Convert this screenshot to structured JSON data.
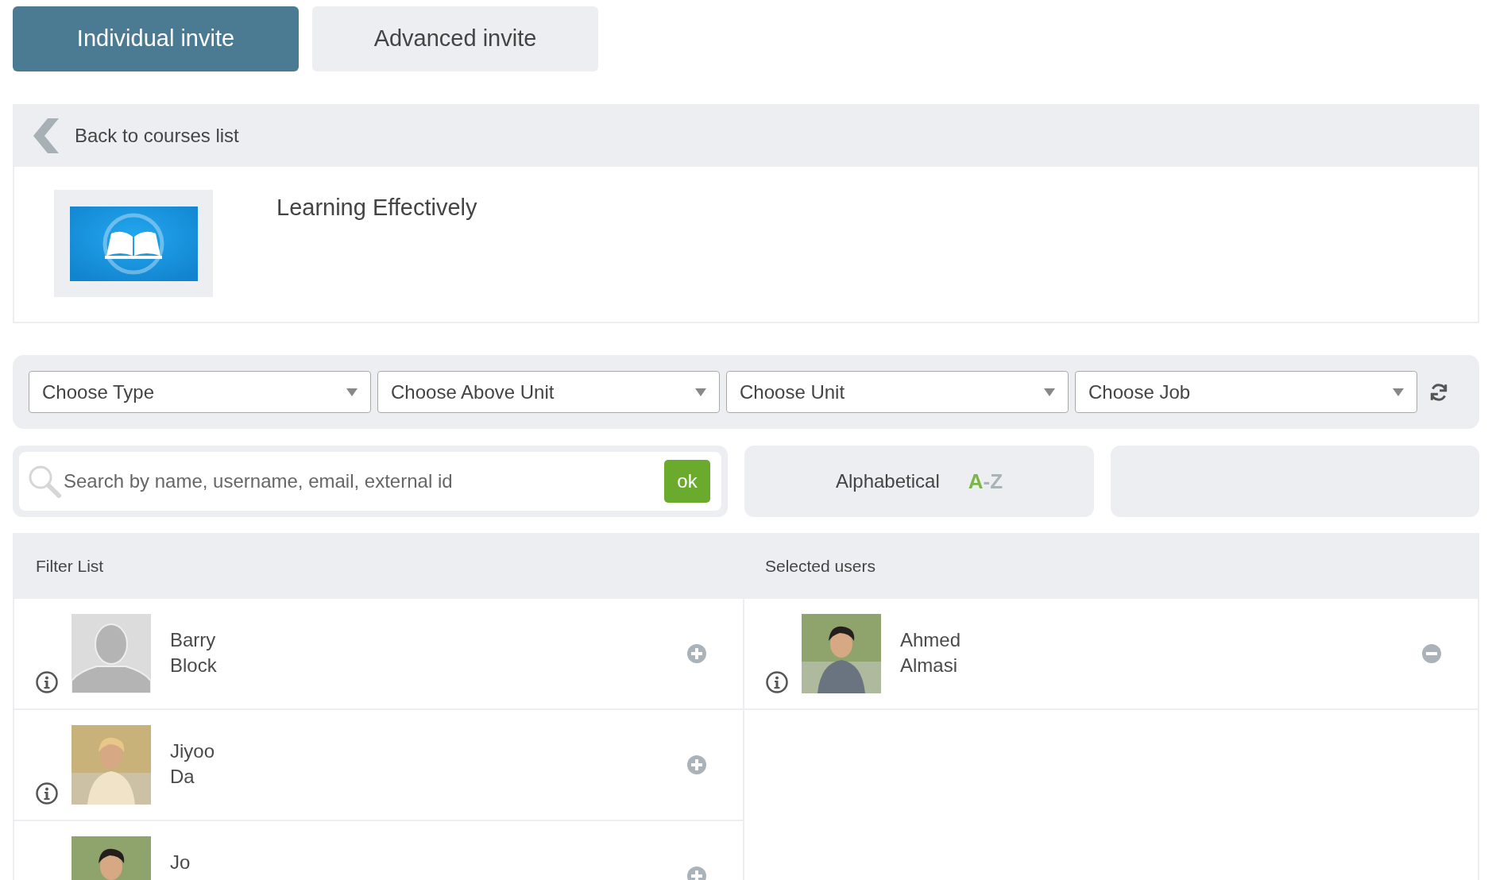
{
  "tabs": [
    {
      "label": "Individual invite",
      "selected": true
    },
    {
      "label": "Advanced invite",
      "selected": false
    }
  ],
  "back_link": "Back to courses list",
  "course": {
    "title": "Learning Effectively"
  },
  "filters": [
    {
      "placeholder": "Choose Type"
    },
    {
      "placeholder": "Choose Above Unit"
    },
    {
      "placeholder": "Choose Unit"
    },
    {
      "placeholder": "Choose Job"
    }
  ],
  "search": {
    "placeholder": "Search by name, username, email, external id",
    "button": "ok"
  },
  "sort": {
    "label": "Alphabetical",
    "order": "A-Z"
  },
  "filter_list": {
    "title": "Filter List",
    "users": [
      {
        "first_name": "Barry",
        "last_name": "Block",
        "kind": "placeholder"
      },
      {
        "first_name": "Jiyoo",
        "last_name": "Da"
      },
      {
        "first_name": "Jo"
      }
    ]
  },
  "selected_users": {
    "title": "Selected users",
    "users": [
      {
        "first_name": "Ahmed",
        "last_name": "Almasi"
      }
    ]
  }
}
